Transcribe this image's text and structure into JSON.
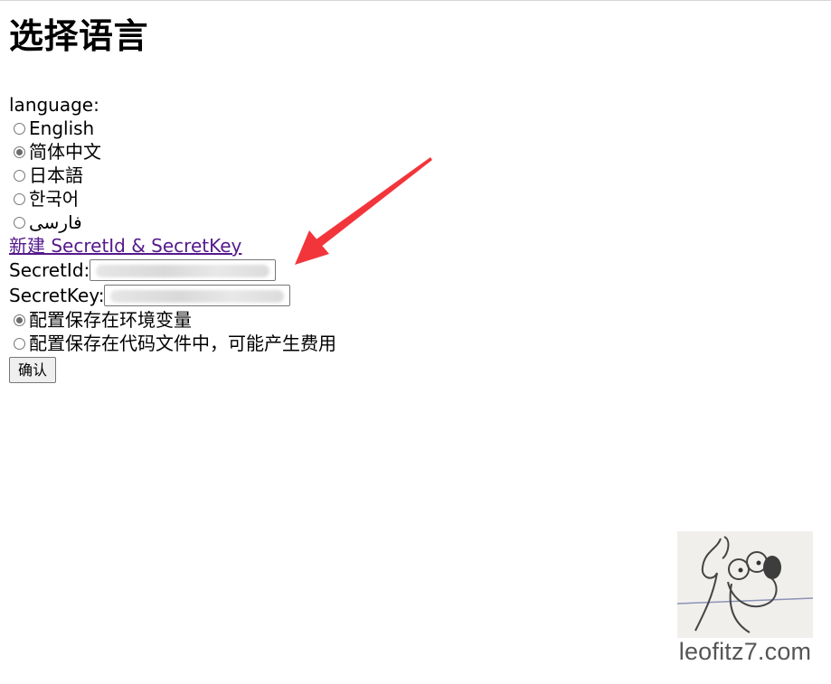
{
  "page": {
    "title": "选择语言",
    "language_label": "language:"
  },
  "languages": [
    {
      "label": "English",
      "selected": false
    },
    {
      "label": "简体中文",
      "selected": true
    },
    {
      "label": "日本語",
      "selected": false
    },
    {
      "label": "한국어",
      "selected": false
    },
    {
      "label": "فارسی",
      "selected": false
    }
  ],
  "secret_link": {
    "label": "新建 SecretId & SecretKey"
  },
  "fields": {
    "secret_id_label": "SecretId:",
    "secret_key_label": "SecretKey:"
  },
  "save_options": [
    {
      "label": "配置保存在环境变量",
      "selected": true
    },
    {
      "label": "配置保存在代码文件中，可能产生费用",
      "selected": false
    }
  ],
  "confirm_button": {
    "label": "确认"
  },
  "annotation": {
    "arrow_color": "#f2353b"
  },
  "watermark": {
    "text": "leofitz7.com"
  }
}
